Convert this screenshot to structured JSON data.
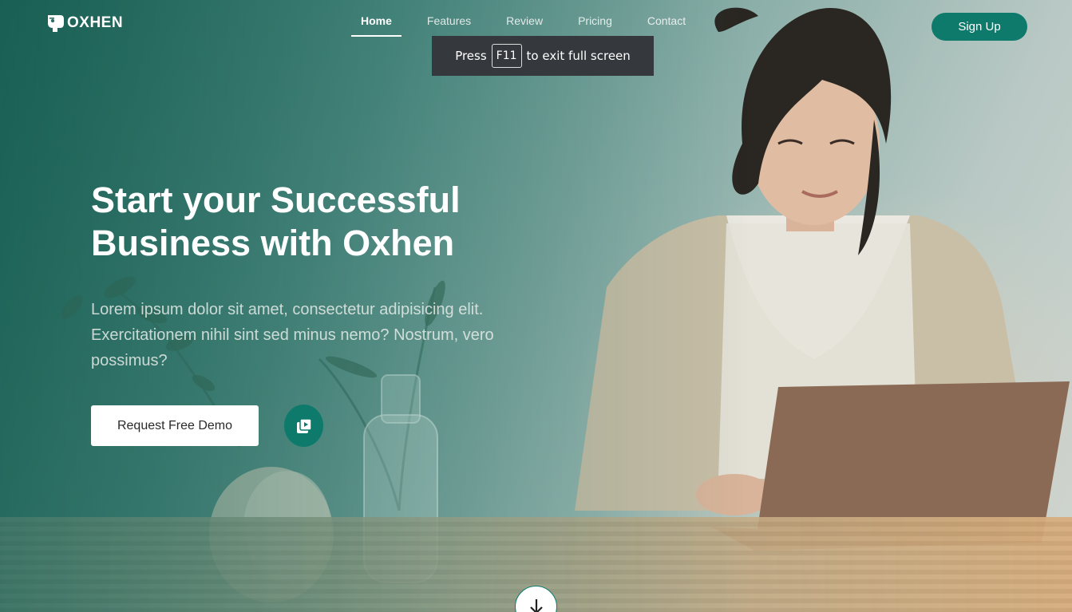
{
  "brand": {
    "name": "OXHEN"
  },
  "nav": {
    "items": [
      {
        "label": "Home",
        "active": true
      },
      {
        "label": "Features",
        "active": false
      },
      {
        "label": "Review",
        "active": false
      },
      {
        "label": "Pricing",
        "active": false
      },
      {
        "label": "Contact",
        "active": false
      }
    ],
    "signup_label": "Sign Up"
  },
  "fullscreen_toast": {
    "prefix": "Press",
    "key": "F11",
    "suffix": "to exit full screen"
  },
  "hero": {
    "title_line1": "Start your Successful",
    "title_line2": "Business with Oxhen",
    "subtext": "Lorem ipsum dolor sit amet, consectetur adipisicing elit. Exercitationem nihil sint sed minus nemo? Nostrum, vero possimus?",
    "demo_label": "Request Free Demo",
    "play_icon": "play-video-icon",
    "scroll_icon": "arrow-down-icon"
  },
  "colors": {
    "accent": "#0d7a6b",
    "overlay": "#1e6458",
    "toast_bg": "#35393d"
  }
}
